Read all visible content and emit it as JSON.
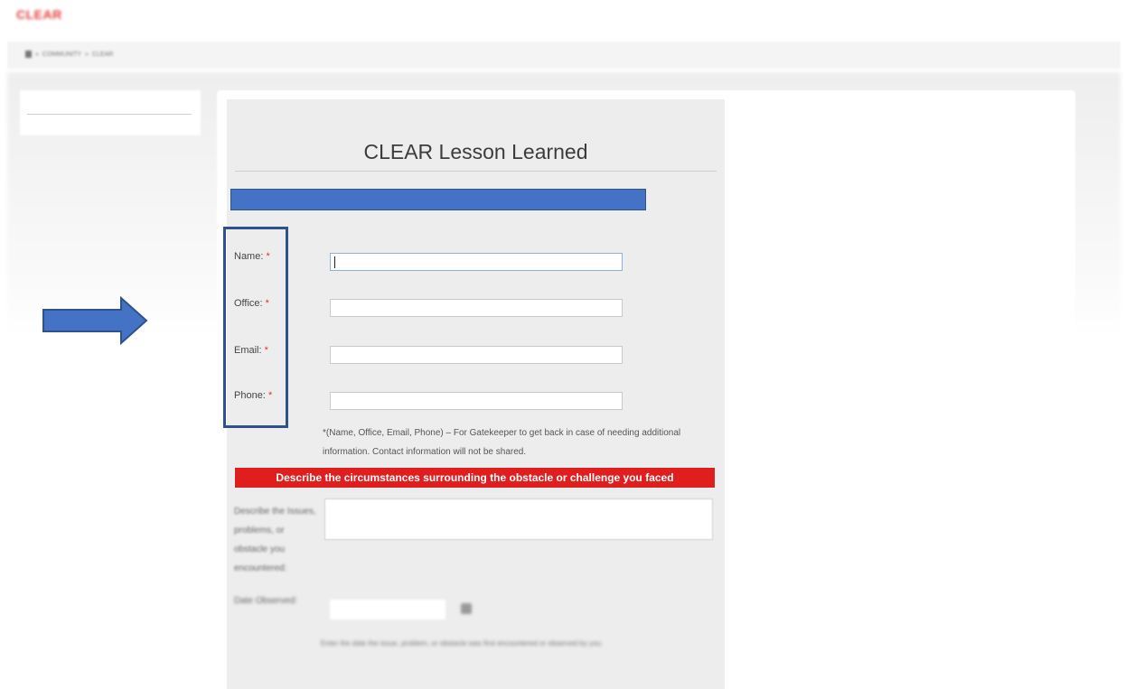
{
  "header": {
    "logo_text": "CLEAR",
    "breadcrumb": [
      "COMMUNITY",
      "CLEAR"
    ]
  },
  "form": {
    "title": "CLEAR Lesson Learned",
    "required_mark": "*",
    "fields": [
      {
        "label": "Name:",
        "value": "",
        "focused": true
      },
      {
        "label": "Office:",
        "value": ""
      },
      {
        "label": "Email:",
        "value": ""
      },
      {
        "label": "Phone:",
        "value": ""
      }
    ],
    "contact_note_line1": "*(Name, Office, Email, Phone) – For Gatekeeper to get back in case of needing additional",
    "contact_note_line2": "information. Contact information will not be shared.",
    "section_header": "Describe the circumstances surrounding the obstacle or challenge you faced",
    "describe_label": "Describe the Issues, problems, or obstacle you encountered:",
    "date_label": "Date Observed:",
    "date_help": "Enter the date the issue, problem, or obstacle was first encountered or observed by you."
  },
  "colors": {
    "section_header_bg": "#e01e1e",
    "annotation_blue": "#4472c4",
    "annotation_border": "#2f528f",
    "form_panel_bg": "#ededed"
  }
}
